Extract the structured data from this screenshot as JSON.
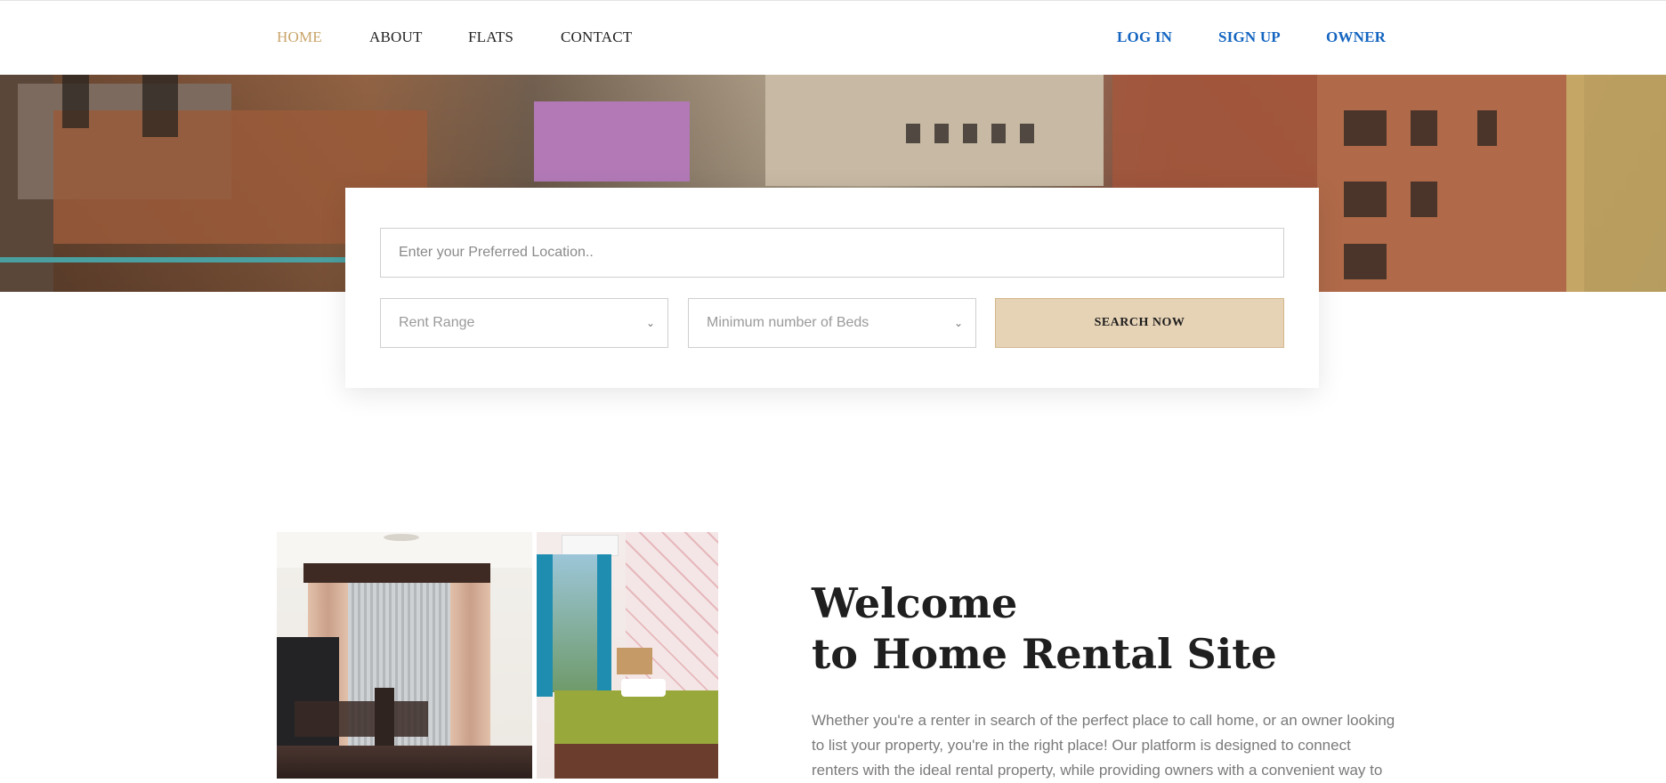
{
  "nav": {
    "home": "HOME",
    "about": "ABOUT",
    "flats": "FLATS",
    "contact": "CONTACT",
    "login": "LOG IN",
    "signup": "SIGN UP",
    "owner": "OWNER"
  },
  "search": {
    "location_placeholder": "Enter your Preferred Location..",
    "rent_range": "Rent Range",
    "min_beds": "Minimum number of Beds",
    "button": "SEARCH NOW"
  },
  "welcome": {
    "title_line1": "Welcome",
    "title_line2": "to Home Rental Site",
    "text": "Whether you're a renter in search of the perfect place to call home, or an owner looking to list your property, you're in the right place! Our platform is designed to connect renters with the ideal rental property, while providing owners with a convenient way to"
  },
  "colors": {
    "active_nav": "#c9a46a",
    "auth_links": "#1565c0",
    "search_button": "#e6d2b5"
  },
  "icons": {
    "select_chevron": "chevron-down-icon"
  }
}
